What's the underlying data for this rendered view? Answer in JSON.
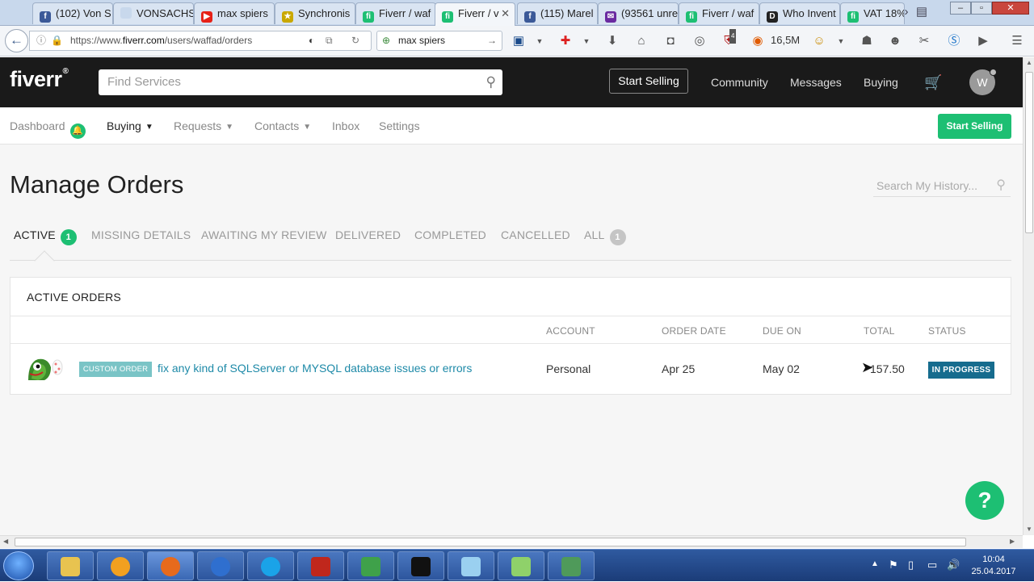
{
  "browser": {
    "tabs": [
      {
        "label": "(102) Von S",
        "fav": "f",
        "fav_color": "#3b5998"
      },
      {
        "label": "VONSACHSEN",
        "fav": "",
        "fav_color": "#c8d8ec"
      },
      {
        "label": "max spiers",
        "fav": "▶",
        "fav_color": "#e62117"
      },
      {
        "label": "Synchronis",
        "fav": "★",
        "fav_color": "#c9a800"
      },
      {
        "label": "Fiverr / waf",
        "fav": "fi",
        "fav_color": "#1dbf73"
      },
      {
        "label": "Fiverr / v",
        "fav": "fi",
        "fav_color": "#1dbf73"
      },
      {
        "label": "(115) Marel",
        "fav": "f",
        "fav_color": "#3b5998"
      },
      {
        "label": "(93561 unre",
        "fav": "✉",
        "fav_color": "#6a2aa0"
      },
      {
        "label": "Fiverr / waf",
        "fav": "fi",
        "fav_color": "#1dbf73"
      },
      {
        "label": "Who Invent",
        "fav": "D",
        "fav_color": "#222222"
      },
      {
        "label": "VAT 18%",
        "fav": "fi",
        "fav_color": "#1dbf73"
      }
    ],
    "active_tab_index": 5,
    "url_prefix": "https://www.",
    "url_domain": "fiverr.com",
    "url_path": "/users/waffad/orders",
    "search_value": "max spiers",
    "toolbar_count": "16,5M",
    "ublock_count": "4"
  },
  "site": {
    "logo": "fiverr",
    "logo_mark": "®",
    "search_placeholder": "Find Services",
    "start_selling": "Start Selling",
    "nav": [
      "Community",
      "Messages",
      "Buying"
    ],
    "avatar_initial": "W"
  },
  "subnav": {
    "items": [
      {
        "label": "Dashboard",
        "current": false
      },
      {
        "label": "Buying",
        "current": true
      },
      {
        "label": "Requests",
        "current": false
      },
      {
        "label": "Contacts",
        "current": false
      },
      {
        "label": "Inbox",
        "current": false
      },
      {
        "label": "Settings",
        "current": false
      }
    ],
    "cta": "Start Selling"
  },
  "page": {
    "title": "Manage Orders",
    "history_placeholder": "Search My History...",
    "tabs": [
      {
        "label": "ACTIVE",
        "count": "1"
      },
      {
        "label": "MISSING DETAILS",
        "count": ""
      },
      {
        "label": "AWAITING MY REVIEW",
        "count": ""
      },
      {
        "label": "DELIVERED",
        "count": ""
      },
      {
        "label": "COMPLETED",
        "count": ""
      },
      {
        "label": "CANCELLED",
        "count": ""
      },
      {
        "label": "ALL",
        "count": "1"
      }
    ],
    "colors": {
      "accent": "#1dbf73",
      "link": "#1e8aa8",
      "status": "#166c8e",
      "badge": "#7ac4c6"
    }
  },
  "orders": {
    "heading": "ACTIVE ORDERS",
    "columns": {
      "account": "ACCOUNT",
      "order_date": "ORDER DATE",
      "due_on": "DUE ON",
      "total": "TOTAL",
      "status": "STATUS"
    },
    "rows": [
      {
        "badge": "CUSTOM ORDER",
        "gig": "fix any kind of SQLServer or MYSQL database issues or errors",
        "account": "Personal",
        "order_date": "Apr 25",
        "due_on": "May 02",
        "total": "157.50",
        "status": "IN PROGRESS"
      }
    ]
  },
  "help_button": "?",
  "taskbar": {
    "time": "10:04",
    "date": "25.04.2017"
  }
}
